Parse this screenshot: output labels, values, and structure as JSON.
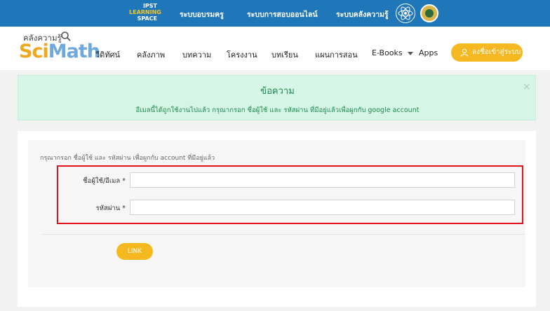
{
  "topbar": {
    "logo": {
      "line1": "IPST",
      "line2": "LEARNING",
      "line3": "SPACE"
    },
    "links": [
      "ระบบอบรมครู",
      "ระบบการสอบออนไลน์",
      "ระบบคลังความรู้"
    ],
    "background": "#1f76b8"
  },
  "brand": {
    "sub": "คลังความรู้",
    "main_sci": "Sci",
    "main_math": "Math"
  },
  "nav": {
    "items": [
      "วีดิทัศน์",
      "คลังภาพ",
      "บทความ",
      "โครงงาน",
      "บทเรียน",
      "แผนการสอน",
      "E-Books",
      "Apps"
    ],
    "login_label": "ลงชื่อเข้าสู่ระบบ",
    "accent": "#f5b820"
  },
  "alert": {
    "title": "ข้อความ",
    "message": "อีเมลนี้ได้ถูกใช้งานไปแล้ว กรุณากรอก ชื่อผู้ใช้ และ รหัสผ่าน ที่มีอยู่แล้วเพื่อผูกกับ google account",
    "close": "×"
  },
  "form": {
    "instruction": "กรุณากรอก ชื่อผู้ใช้ และ รหัสผ่าน เพื่อผูกกับ account ที่มีอยู่แล้ว",
    "username_label": "ชื่อผู้ใช้/อีเมล *",
    "username_value": "",
    "password_label": "รหัสผ่าน *",
    "password_value": "",
    "submit_label": "LINK"
  }
}
